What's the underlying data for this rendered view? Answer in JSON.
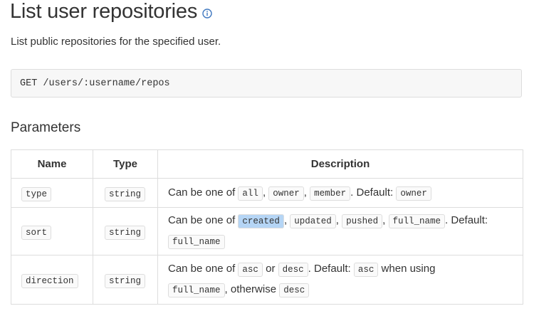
{
  "page": {
    "title": "List user repositories",
    "subtitle": "List public repositories for the specified user.",
    "endpoint": "GET /users/:username/repos",
    "params_heading": "Parameters"
  },
  "table": {
    "headers": [
      "Name",
      "Type",
      "Description"
    ],
    "rows": [
      {
        "name": "type",
        "type": "string",
        "desc_prefix": "Can be one of",
        "options": [
          "all",
          "owner",
          "member"
        ],
        "default_label": "Default:",
        "default": "owner"
      },
      {
        "name": "sort",
        "type": "string",
        "desc_prefix": "Can be one of",
        "options": [
          "created",
          "updated",
          "pushed",
          "full_name"
        ],
        "default_label": "Default:",
        "default": "full_name"
      },
      {
        "name": "direction",
        "type": "string",
        "desc_prefix": "Can be one of",
        "opt1": "asc",
        "or": "or",
        "opt2": "desc",
        "default_label": "Default:",
        "default": "asc",
        "when_using": "when using",
        "cond": "full_name",
        "otherwise": ", otherwise",
        "else": "desc"
      }
    ]
  },
  "icons": {
    "info": "info-icon"
  },
  "colors": {
    "highlight": "#b5d5f5",
    "code_bg": "#fafafa",
    "border": "#dddddd"
  }
}
